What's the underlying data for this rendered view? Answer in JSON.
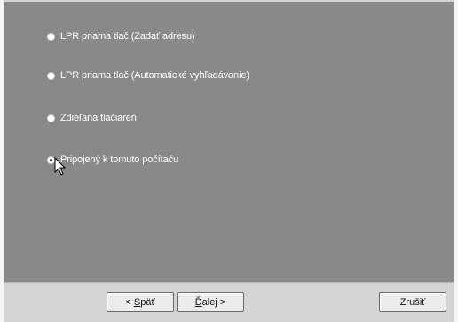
{
  "options": [
    {
      "label": "LPR priama tlač (Zadať adresu)",
      "selected": false
    },
    {
      "label": "LPR priama tlač (Automatické vyhľadávanie)",
      "selected": false
    },
    {
      "label": "Zdieľaná tlačiareň",
      "selected": false
    },
    {
      "label": "Pripojený k tomuto počítaču",
      "selected": true
    }
  ],
  "buttons": {
    "back": {
      "prefix": "< ",
      "mnemonic": "S",
      "rest": "päť"
    },
    "next": {
      "mnemonic": "Ď",
      "rest": "alej >"
    },
    "cancel": {
      "label": "Zrušiť"
    }
  },
  "colors": {
    "panel": "#898989",
    "frame": "#d4d4d4"
  },
  "icons": {
    "cursor": "mouse-pointer-icon"
  }
}
